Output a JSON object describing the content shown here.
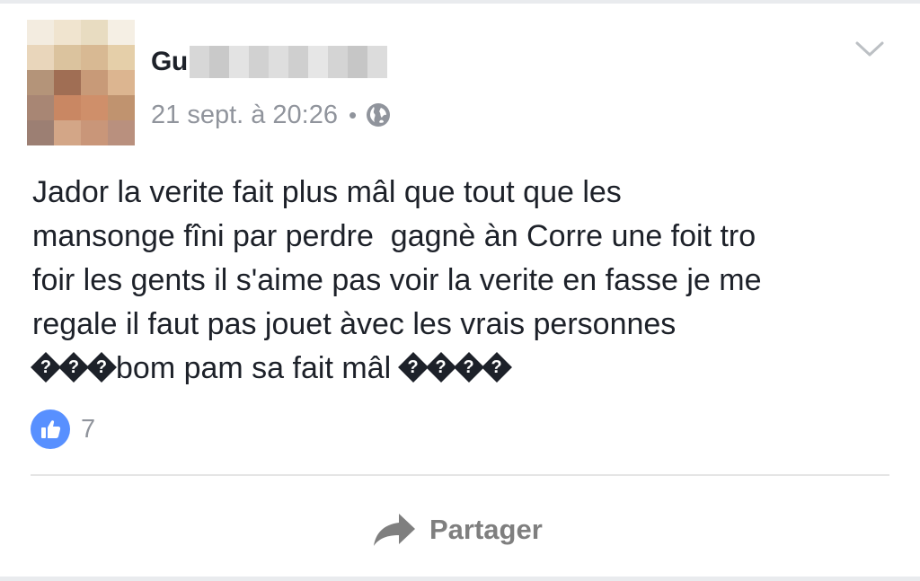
{
  "post": {
    "author_visible": "Gu",
    "timestamp": "21 sept. à 20:26",
    "meta_separator": "•",
    "privacy_icon": "globe-icon",
    "menu_icon": "chevron-down-icon",
    "text": "Jador la verite fait plus mâl que tout que les\nmansonge fîni par perdre  gagnè àn Corre une foit tro\nfoir les gents il s'aime pas voir la verite en fasse je me\nregale il faut pas jouet àvec les vrais personnes\n���bom pam sa fait mâl ����"
  },
  "reactions": {
    "icon": "like-icon",
    "count": "7"
  },
  "actions": {
    "share_icon": "share-arrow-icon",
    "share_label": "Partager"
  },
  "colors": {
    "text": "#1d2129",
    "meta": "#90949c",
    "like_blue": "#5890ff",
    "action_gray": "#7f7f7f"
  }
}
